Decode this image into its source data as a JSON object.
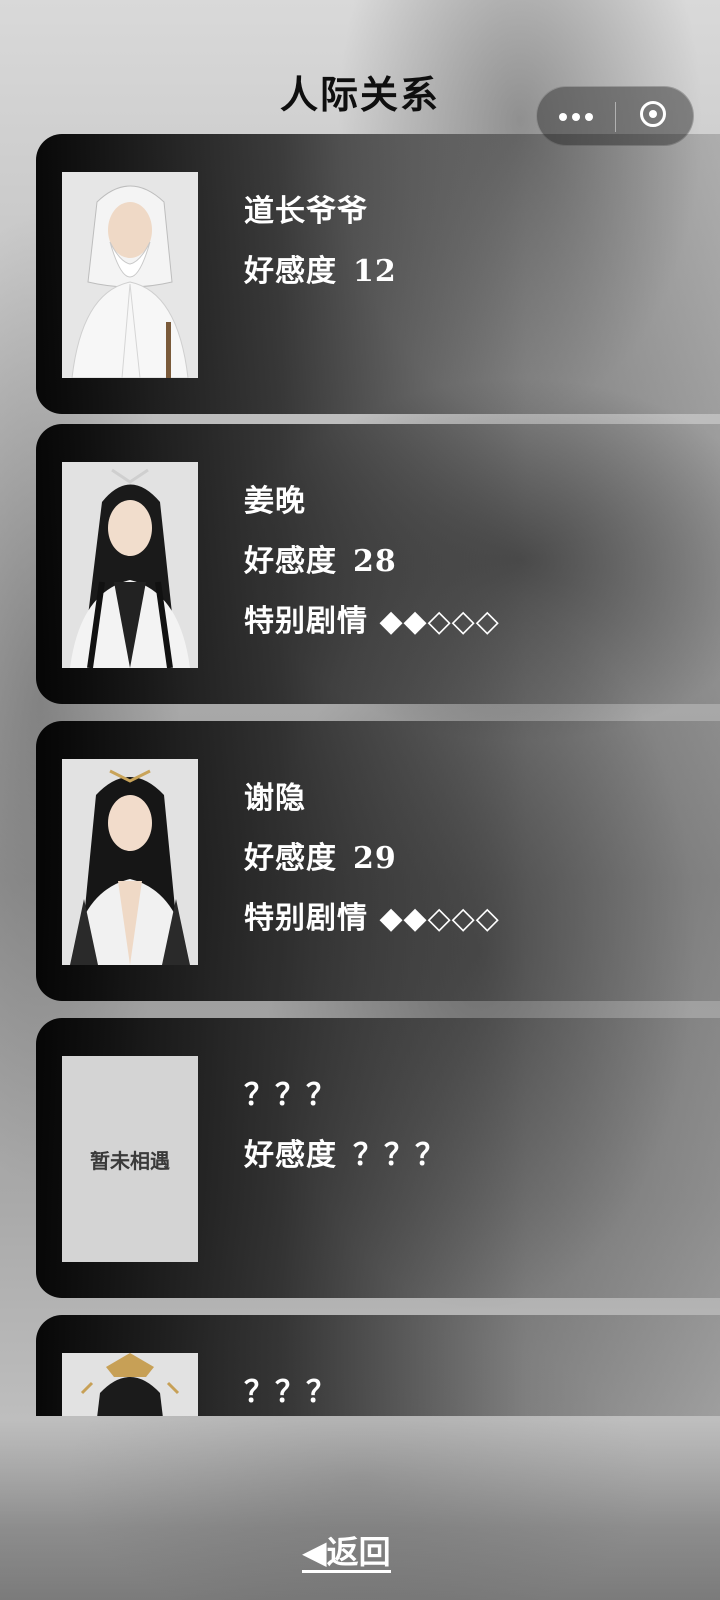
{
  "header": {
    "title": "人际关系"
  },
  "capsule": {
    "more_icon": "more-dots-icon",
    "close_icon": "target-circle-icon"
  },
  "characters": [
    {
      "name": "道长爷爷",
      "affinity_label": "好感度",
      "affinity_value": "12",
      "story_label": "",
      "story_stars": "",
      "portrait": "old-taoist-portrait"
    },
    {
      "name": "姜晚",
      "affinity_label": "好感度",
      "affinity_value": "28",
      "story_label": "特别剧情",
      "story_stars": "◆◆◇◇◇",
      "portrait": "jiang-wan-portrait"
    },
    {
      "name": "谢隐",
      "affinity_label": "好感度",
      "affinity_value": "29",
      "story_label": "特别剧情",
      "story_stars": "◆◆◇◇◇",
      "portrait": "xie-yin-portrait"
    },
    {
      "name": "？？？",
      "affinity_label": "好感度",
      "affinity_value": "？？？",
      "story_label": "",
      "story_stars": "",
      "portrait_text": "暂未相遇"
    },
    {
      "name": "？？？",
      "affinity_label": "",
      "affinity_value": "",
      "story_label": "",
      "story_stars": "",
      "portrait": "unknown-portrait"
    }
  ],
  "footer": {
    "back_label": "◀返回"
  }
}
